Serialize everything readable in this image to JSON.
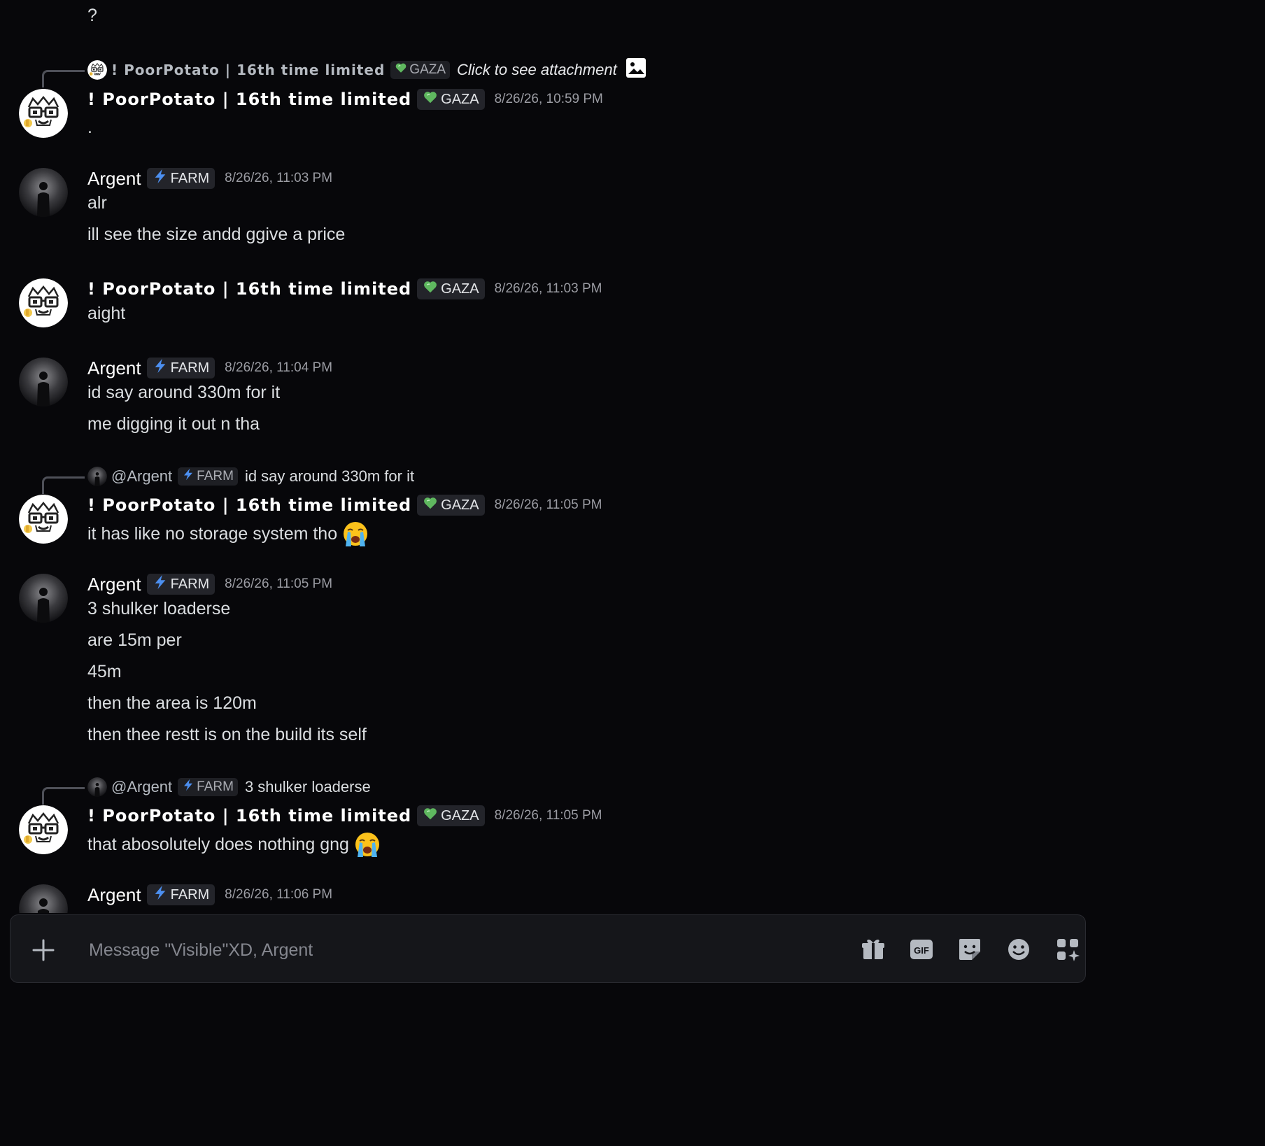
{
  "authors": {
    "potato": "! PoorPotato | 16th time limited",
    "argent": "Argent"
  },
  "tags": {
    "gaza": "GAZA",
    "farm": "FARM"
  },
  "top_text": "?",
  "messages": [
    {
      "reply": {
        "author": "! PoorPotato | 16th time limited",
        "tag": "GAZA",
        "attachment_text": "Click to see attachment"
      },
      "author": "! PoorPotato | 16th time limited",
      "tag": "GAZA",
      "timestamp": "8/26/26, 10:59 PM",
      "lines": [
        "."
      ]
    },
    {
      "author": "Argent",
      "tag": "FARM",
      "timestamp": "8/26/26, 11:03 PM",
      "lines": [
        "alr",
        "ill see the size andd ggive a price"
      ]
    },
    {
      "author": "! PoorPotato | 16th time limited",
      "tag": "GAZA",
      "timestamp": "8/26/26, 11:03 PM",
      "lines": [
        "aight"
      ]
    },
    {
      "author": "Argent",
      "tag": "FARM",
      "timestamp": "8/26/26, 11:04 PM",
      "lines": [
        "id say around 330m for it",
        "me digging it out n tha"
      ]
    },
    {
      "reply": {
        "author": "@Argent",
        "tag": "FARM",
        "text": "id say around 330m for it"
      },
      "author": "! PoorPotato | 16th time limited",
      "tag": "GAZA",
      "timestamp": "8/26/26, 11:05 PM",
      "lines": [
        "it has like no storage system tho"
      ],
      "emoji": "loudly-crying-face"
    },
    {
      "author": "Argent",
      "tag": "FARM",
      "timestamp": "8/26/26, 11:05 PM",
      "lines": [
        "3 shulker loaderse",
        "are 15m per",
        "45m",
        "then the area is 120m",
        "then thee restt is on the build its self"
      ]
    },
    {
      "reply": {
        "author": "@Argent",
        "tag": "FARM",
        "text": "3 shulker loaderse"
      },
      "author": "! PoorPotato | 16th time limited",
      "tag": "GAZA",
      "timestamp": "8/26/26, 11:05 PM",
      "lines": [
        "that abosolutely does nothing gng"
      ],
      "emoji": "loudly-crying-face"
    },
    {
      "author": "Argent",
      "tag": "FARM",
      "timestamp": "8/26/26, 11:06 PM",
      "lines": []
    }
  ],
  "composer": {
    "placeholder": "Message \"Visible\"XD, Argent",
    "gif_label": "GIF",
    "buttons": [
      "plus-icon",
      "gift-icon",
      "gif-icon",
      "sticker-icon",
      "emoji-icon",
      "apps-icon"
    ]
  },
  "colors": {
    "background": "#07070a",
    "tag_background": "#23242a",
    "gaza_heart": "#5fb85f",
    "farm_bolt": "#4c8ff0",
    "timestamp": "#9b9ca3"
  }
}
